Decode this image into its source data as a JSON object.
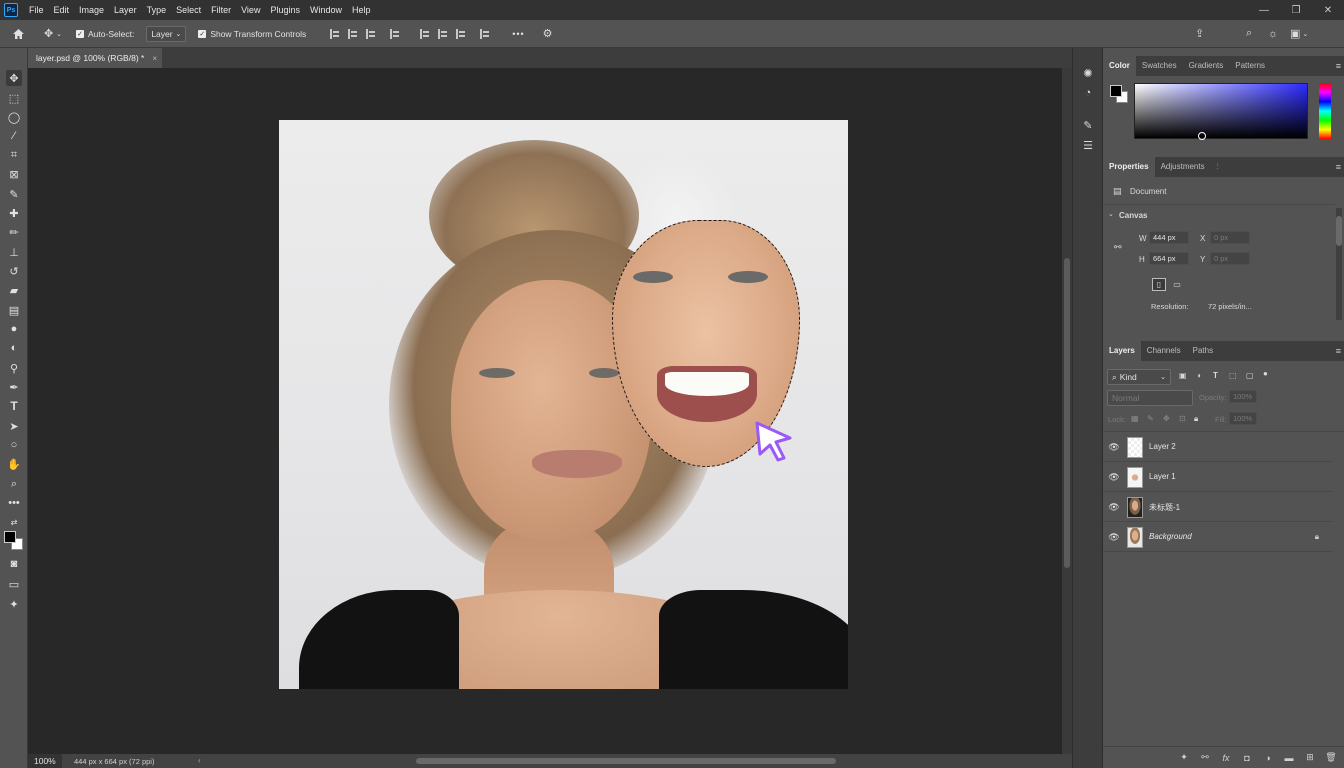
{
  "app": {
    "logo": "Ps"
  },
  "menu": [
    "File",
    "Edit",
    "Image",
    "Layer",
    "Type",
    "Select",
    "Filter",
    "View",
    "Plugins",
    "Window",
    "Help"
  ],
  "options_bar": {
    "auto_select_label": "Auto-Select:",
    "auto_select_checked": true,
    "auto_select_target": "Layer",
    "show_transform_label": "Show Transform Controls",
    "show_transform_checked": true,
    "more_label": "•••"
  },
  "document_tab": {
    "title": "layer.psd @ 100% (RGB/8) *",
    "close": "×"
  },
  "color_panel": {
    "tabs": [
      "Color",
      "Swatches",
      "Gradients",
      "Patterns"
    ],
    "active_tab": "Color",
    "foreground": "#000000",
    "background": "#ffffff"
  },
  "properties_panel": {
    "tabs": [
      "Properties",
      "Adjustments"
    ],
    "active_tab": "Properties",
    "section_label": "Document",
    "canvas_label": "Canvas",
    "w_label": "W",
    "w_value": "444 px",
    "h_label": "H",
    "h_value": "664 px",
    "x_label": "X",
    "x_value": "0 px",
    "y_label": "Y",
    "y_value": "0 px",
    "resolution_label": "Resolution:",
    "resolution_value": "72 pixels/in..."
  },
  "layers_panel": {
    "tabs": [
      "Layers",
      "Channels",
      "Paths"
    ],
    "active_tab": "Layers",
    "filter_label": "Kind",
    "blend_mode": "Normal",
    "opacity_label": "Opacity:",
    "opacity_value": "100%",
    "lock_label": "Lock:",
    "fill_label": "Fill:",
    "fill_value": "100%",
    "layers": [
      {
        "name": "Layer 2",
        "visible": true,
        "locked": false
      },
      {
        "name": "Layer 1",
        "visible": true,
        "locked": false
      },
      {
        "name": "未标题-1",
        "visible": true,
        "locked": false
      },
      {
        "name": "Background",
        "visible": true,
        "locked": true
      }
    ]
  },
  "status_bar": {
    "zoom": "100%",
    "doc_info": "444 px x 664 px (72 ppi)"
  },
  "colors": {
    "accent_cursor": "#9b59f5",
    "panel_bg": "#535353",
    "canvas_bg": "#282828"
  }
}
